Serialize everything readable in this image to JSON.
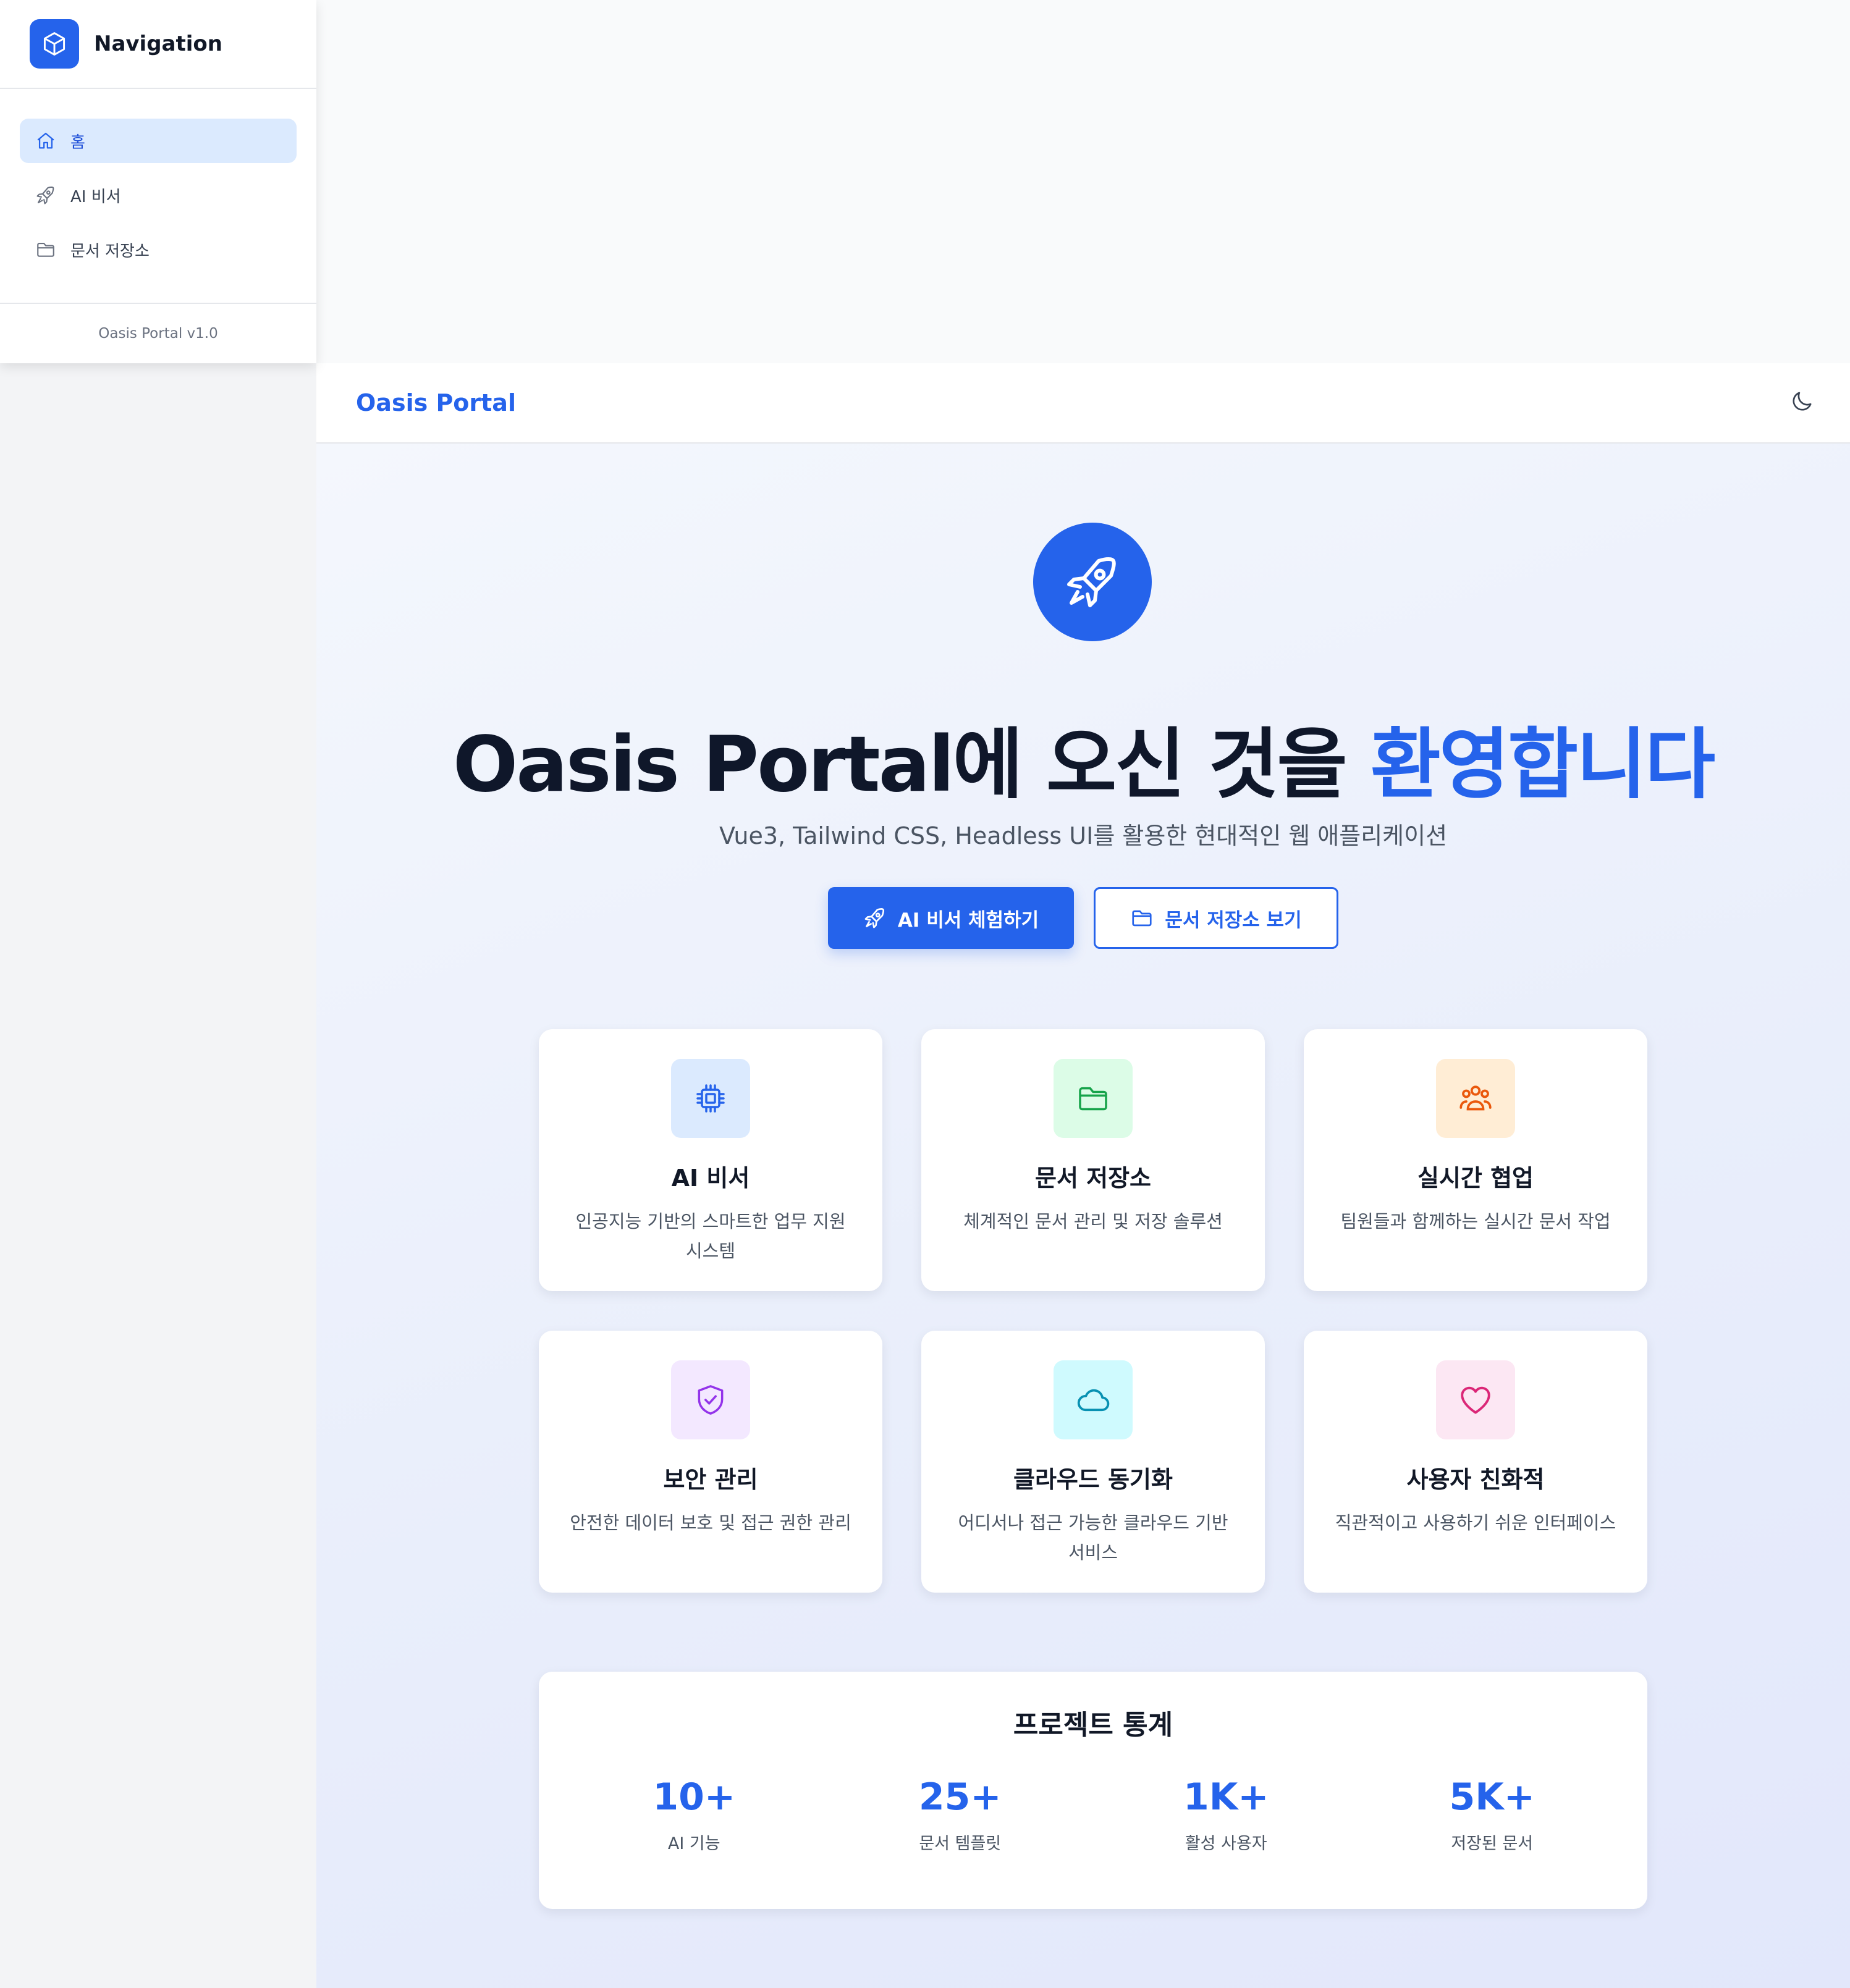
{
  "sidebar": {
    "title": "Navigation",
    "logo_icon": "cube-icon",
    "items": [
      {
        "label": "홈",
        "icon": "home-icon",
        "active": true
      },
      {
        "label": "AI 비서",
        "icon": "rocket-icon",
        "active": false
      },
      {
        "label": "문서 저장소",
        "icon": "folder-icon",
        "active": false
      }
    ],
    "footer": "Oasis Portal v1.0"
  },
  "header": {
    "brand": "Oasis Portal",
    "theme_toggle_icon": "moon-icon"
  },
  "hero": {
    "icon": "rocket-icon",
    "title_main": "Oasis Portal에 오신 것을 ",
    "title_accent": "환영합니다",
    "subtitle": "Vue3, Tailwind CSS, Headless UI를 활용한 현대적인 웹 애플리케이션",
    "primary_button": "AI 비서 체험하기",
    "secondary_button": "문서 저장소 보기"
  },
  "features": [
    {
      "title": "AI 비서",
      "desc": "인공지능 기반의 스마트한 업무 지원 시스템",
      "icon": "chip-icon",
      "bg": "#dbeafe",
      "color": "#2563eb"
    },
    {
      "title": "문서 저장소",
      "desc": "체계적인 문서 관리 및 저장 솔루션",
      "icon": "folder-icon",
      "bg": "#dcfce7",
      "color": "#16a34a"
    },
    {
      "title": "실시간 협업",
      "desc": "팀원들과 함께하는 실시간 문서 작업",
      "icon": "users-icon",
      "bg": "#ffedd5",
      "color": "#ea580c"
    },
    {
      "title": "보안 관리",
      "desc": "안전한 데이터 보호 및 접근 권한 관리",
      "icon": "shield-check-icon",
      "bg": "#f3e8ff",
      "color": "#9333ea"
    },
    {
      "title": "클라우드 동기화",
      "desc": "어디서나 접근 가능한 클라우드 기반 서비스",
      "icon": "cloud-icon",
      "bg": "#cffafe",
      "color": "#0891b2"
    },
    {
      "title": "사용자 친화적",
      "desc": "직관적이고 사용하기 쉬운 인터페이스",
      "icon": "heart-icon",
      "bg": "#fce7f3",
      "color": "#db2777"
    }
  ],
  "stats": {
    "title": "프로젝트 통계",
    "items": [
      {
        "value": "10+",
        "label": "AI 기능"
      },
      {
        "value": "25+",
        "label": "문서 템플릿"
      },
      {
        "value": "1K+",
        "label": "활성 사용자"
      },
      {
        "value": "5K+",
        "label": "저장된 문서"
      }
    ]
  },
  "colors": {
    "accent": "#2563eb",
    "active_bg": "#dbeafe"
  }
}
